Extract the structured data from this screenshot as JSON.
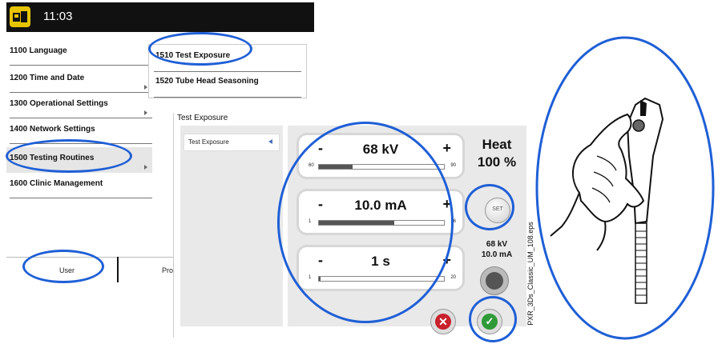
{
  "header": {
    "time": "11:03"
  },
  "menu": {
    "items": [
      {
        "label": "1100  Language"
      },
      {
        "label": "1200  Time and Date"
      },
      {
        "label": "1300  Operational Settings"
      },
      {
        "label": "1400  Network Settings"
      },
      {
        "label": "1500  Testing Routines"
      },
      {
        "label": "1600  Clinic Management"
      }
    ],
    "submenu": [
      {
        "label": "1510  Test Exposure"
      },
      {
        "label": "1520  Tube Head Seasoning"
      }
    ]
  },
  "tabs": {
    "user": "User",
    "prog": "Prog"
  },
  "dialog": {
    "title": "Test Exposure",
    "list_item": "Test Exposure",
    "kv": {
      "minus": "-",
      "value": "68 kV",
      "plus": "+",
      "min": "60",
      "max": "90",
      "level": 0.27
    },
    "ma": {
      "minus": "-",
      "value": "10.0 mA",
      "plus": "+",
      "min": "1",
      "max": "16",
      "level": 0.6
    },
    "time": {
      "minus": "-",
      "value": "1 s",
      "plus": "+",
      "min": "1",
      "max": "20",
      "level": 0.01
    },
    "heat_label": "Heat",
    "heat_value": "100 %",
    "set_label": "SET",
    "summary_kv": "68 kV",
    "summary_ma": "10.0 mA"
  },
  "caption": "PXR_3Ds_Classic_UM_108.eps",
  "colors": {
    "highlight": "#1f5fd6",
    "logo": "#e7c400",
    "cancel": "#c8202c",
    "ok": "#2e9a38"
  }
}
